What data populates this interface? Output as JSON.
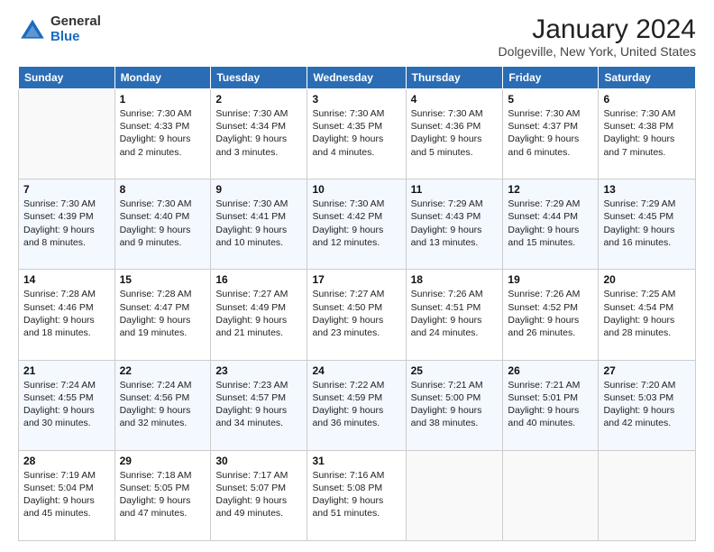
{
  "header": {
    "logo_general": "General",
    "logo_blue": "Blue",
    "month_title": "January 2024",
    "location": "Dolgeville, New York, United States"
  },
  "calendar": {
    "days_of_week": [
      "Sunday",
      "Monday",
      "Tuesday",
      "Wednesday",
      "Thursday",
      "Friday",
      "Saturday"
    ],
    "weeks": [
      [
        {
          "day": "",
          "info": ""
        },
        {
          "day": "1",
          "info": "Sunrise: 7:30 AM\nSunset: 4:33 PM\nDaylight: 9 hours\nand 2 minutes."
        },
        {
          "day": "2",
          "info": "Sunrise: 7:30 AM\nSunset: 4:34 PM\nDaylight: 9 hours\nand 3 minutes."
        },
        {
          "day": "3",
          "info": "Sunrise: 7:30 AM\nSunset: 4:35 PM\nDaylight: 9 hours\nand 4 minutes."
        },
        {
          "day": "4",
          "info": "Sunrise: 7:30 AM\nSunset: 4:36 PM\nDaylight: 9 hours\nand 5 minutes."
        },
        {
          "day": "5",
          "info": "Sunrise: 7:30 AM\nSunset: 4:37 PM\nDaylight: 9 hours\nand 6 minutes."
        },
        {
          "day": "6",
          "info": "Sunrise: 7:30 AM\nSunset: 4:38 PM\nDaylight: 9 hours\nand 7 minutes."
        }
      ],
      [
        {
          "day": "7",
          "info": "Sunrise: 7:30 AM\nSunset: 4:39 PM\nDaylight: 9 hours\nand 8 minutes."
        },
        {
          "day": "8",
          "info": "Sunrise: 7:30 AM\nSunset: 4:40 PM\nDaylight: 9 hours\nand 9 minutes."
        },
        {
          "day": "9",
          "info": "Sunrise: 7:30 AM\nSunset: 4:41 PM\nDaylight: 9 hours\nand 10 minutes."
        },
        {
          "day": "10",
          "info": "Sunrise: 7:30 AM\nSunset: 4:42 PM\nDaylight: 9 hours\nand 12 minutes."
        },
        {
          "day": "11",
          "info": "Sunrise: 7:29 AM\nSunset: 4:43 PM\nDaylight: 9 hours\nand 13 minutes."
        },
        {
          "day": "12",
          "info": "Sunrise: 7:29 AM\nSunset: 4:44 PM\nDaylight: 9 hours\nand 15 minutes."
        },
        {
          "day": "13",
          "info": "Sunrise: 7:29 AM\nSunset: 4:45 PM\nDaylight: 9 hours\nand 16 minutes."
        }
      ],
      [
        {
          "day": "14",
          "info": "Sunrise: 7:28 AM\nSunset: 4:46 PM\nDaylight: 9 hours\nand 18 minutes."
        },
        {
          "day": "15",
          "info": "Sunrise: 7:28 AM\nSunset: 4:47 PM\nDaylight: 9 hours\nand 19 minutes."
        },
        {
          "day": "16",
          "info": "Sunrise: 7:27 AM\nSunset: 4:49 PM\nDaylight: 9 hours\nand 21 minutes."
        },
        {
          "day": "17",
          "info": "Sunrise: 7:27 AM\nSunset: 4:50 PM\nDaylight: 9 hours\nand 23 minutes."
        },
        {
          "day": "18",
          "info": "Sunrise: 7:26 AM\nSunset: 4:51 PM\nDaylight: 9 hours\nand 24 minutes."
        },
        {
          "day": "19",
          "info": "Sunrise: 7:26 AM\nSunset: 4:52 PM\nDaylight: 9 hours\nand 26 minutes."
        },
        {
          "day": "20",
          "info": "Sunrise: 7:25 AM\nSunset: 4:54 PM\nDaylight: 9 hours\nand 28 minutes."
        }
      ],
      [
        {
          "day": "21",
          "info": "Sunrise: 7:24 AM\nSunset: 4:55 PM\nDaylight: 9 hours\nand 30 minutes."
        },
        {
          "day": "22",
          "info": "Sunrise: 7:24 AM\nSunset: 4:56 PM\nDaylight: 9 hours\nand 32 minutes."
        },
        {
          "day": "23",
          "info": "Sunrise: 7:23 AM\nSunset: 4:57 PM\nDaylight: 9 hours\nand 34 minutes."
        },
        {
          "day": "24",
          "info": "Sunrise: 7:22 AM\nSunset: 4:59 PM\nDaylight: 9 hours\nand 36 minutes."
        },
        {
          "day": "25",
          "info": "Sunrise: 7:21 AM\nSunset: 5:00 PM\nDaylight: 9 hours\nand 38 minutes."
        },
        {
          "day": "26",
          "info": "Sunrise: 7:21 AM\nSunset: 5:01 PM\nDaylight: 9 hours\nand 40 minutes."
        },
        {
          "day": "27",
          "info": "Sunrise: 7:20 AM\nSunset: 5:03 PM\nDaylight: 9 hours\nand 42 minutes."
        }
      ],
      [
        {
          "day": "28",
          "info": "Sunrise: 7:19 AM\nSunset: 5:04 PM\nDaylight: 9 hours\nand 45 minutes."
        },
        {
          "day": "29",
          "info": "Sunrise: 7:18 AM\nSunset: 5:05 PM\nDaylight: 9 hours\nand 47 minutes."
        },
        {
          "day": "30",
          "info": "Sunrise: 7:17 AM\nSunset: 5:07 PM\nDaylight: 9 hours\nand 49 minutes."
        },
        {
          "day": "31",
          "info": "Sunrise: 7:16 AM\nSunset: 5:08 PM\nDaylight: 9 hours\nand 51 minutes."
        },
        {
          "day": "",
          "info": ""
        },
        {
          "day": "",
          "info": ""
        },
        {
          "day": "",
          "info": ""
        }
      ]
    ]
  }
}
